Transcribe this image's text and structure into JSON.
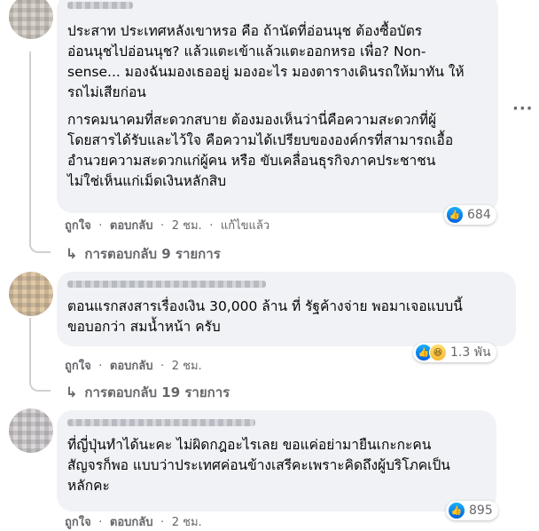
{
  "comments": [
    {
      "para1": "ประสาท ประเทศหลังเขาหรอ คือ ถ้านัดที่อ่อนนุช ต้องซื้อบัตร\nอ่อนนุชไปอ่อนนุช? แล้วแตะเข้าแล้วแตะออกหรอ เพื่อ? Non-\nsense... มองฉันมองเธออยู่ มองอะไร มองตารางเดินรถให้มาทัน ให้\nรถไม่เสียก่อน",
      "para2": "การคมนาคมที่สะดวกสบาย ต้องมองเห็นว่านี่คือความสะดวกที่ผู้\nโดยสารได้รับและไว้ใจ คือความได้เปรียบขององค์กรที่สามารถเอื้อ\nอำนวยความสะดวกแก่ผู้คน หรือ ขับเคลื่อนธุรกิจภาคประชาชน\nไม่ใช่เห็นแก่เม็ดเงินหลักสิบ",
      "like": "ถูกใจ",
      "reply": "ตอบกลับ",
      "time": "2 ชม.",
      "edited": "แก้ไขแล้ว",
      "reaction_count": "684",
      "reactions": [
        "like-icon"
      ],
      "replies_label": "การตอบกลับ 9 รายการ"
    },
    {
      "para1": "ตอนแรกสงสารเรื่องเงิน 30,000 ล้าน ที่ รัฐค้างจ่าย พอมาเจอแบบนี้\nขอบอกว่า สมน้ำหน้า ครับ",
      "like": "ถูกใจ",
      "reply": "ตอบกลับ",
      "time": "2 ชม.",
      "reaction_count": "1.3 พัน",
      "reactions": [
        "like-icon",
        "haha-icon"
      ],
      "replies_label": "การตอบกลับ 19 รายการ"
    },
    {
      "para1": "ที่ญี่ปุ่นทำได้นะคะ ไม่ผิดกฎอะไรเลย ขอแค่อย่ามายืนเกะกะคน\nสัญจรก็พอ แบบว่าประเทศค่อนข้างเสรีคะเพราะคิดถึงผู้บริโภคเป็น\nหลักคะ",
      "like": "ถูกใจ",
      "reply": "ตอบกลับ",
      "time": "2 ชม.",
      "reaction_count": "895",
      "reactions": [
        "like-icon"
      ]
    }
  ],
  "symbols": {
    "dot": "·",
    "more": "···",
    "reply_arrow": "↳"
  },
  "colors": {
    "bubble": "#f0f2f5",
    "meta": "#65676b",
    "like_blue": "#1877f2"
  }
}
